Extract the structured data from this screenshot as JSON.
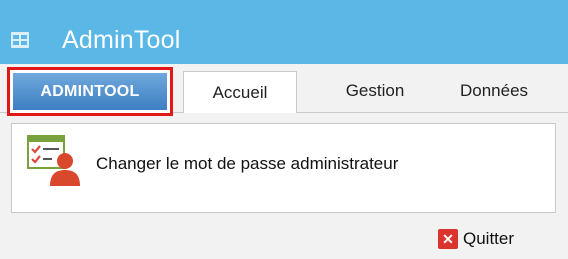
{
  "window": {
    "title": "AdminTool",
    "icon": "app-icon",
    "titlebar_color": "#5ab7e6"
  },
  "ribbon": {
    "application_tab_label": "ADMINTOOL",
    "tabs": [
      {
        "label": "Accueil",
        "selected": true
      },
      {
        "label": "Gestion",
        "selected": false
      },
      {
        "label": "Données",
        "selected": false
      }
    ],
    "highlight_color": "#e01818"
  },
  "panel": {
    "item": {
      "label": "Changer le mot de passe administrateur",
      "icon": "admin-password-icon"
    }
  },
  "footer": {
    "quit": {
      "label": "Quitter",
      "icon": "close-icon",
      "icon_color": "#d9352e"
    }
  }
}
